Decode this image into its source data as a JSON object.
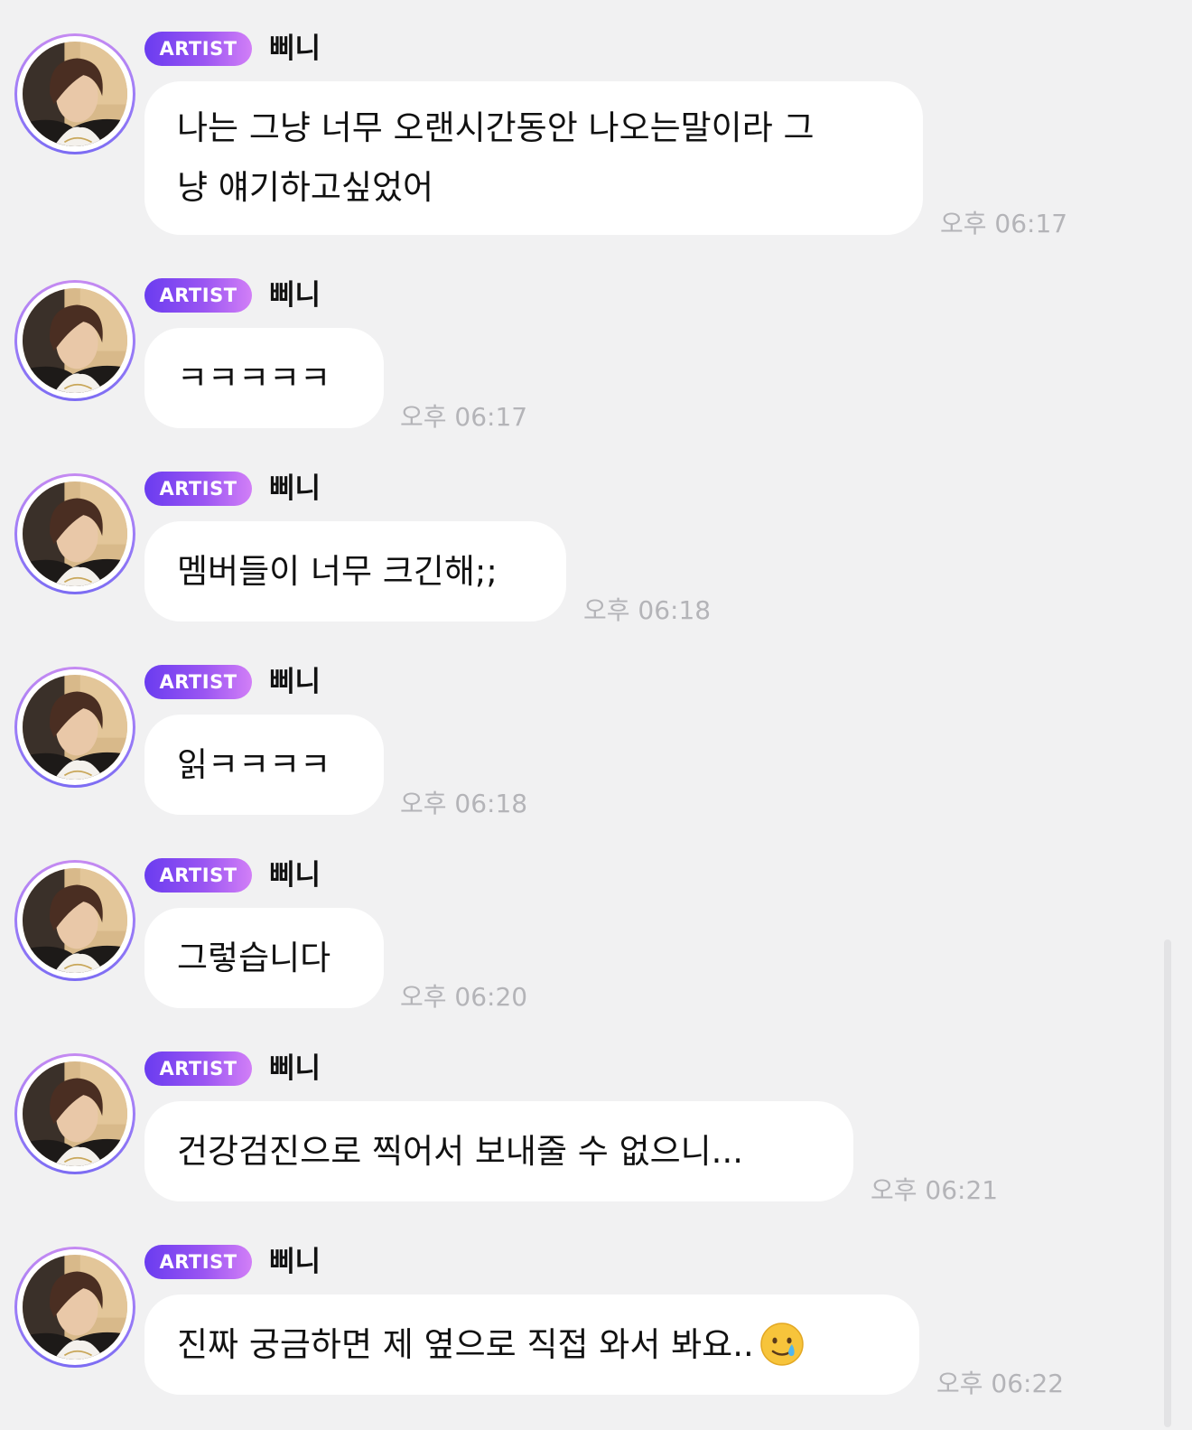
{
  "colors": {
    "background": "#f1f1f2",
    "bubble": "#ffffff",
    "badge_gradient_start": "#6a3cf0",
    "badge_gradient_end": "#d27ff7",
    "timestamp": "#b4b4b8"
  },
  "messages": [
    {
      "badge": "ARTIST",
      "sender": "삐니",
      "text": "나는 그냥 너무 오랜시간동안 나오는말이라 그\n냥 얘기하고싶었어",
      "time": "오후 06:17"
    },
    {
      "badge": "ARTIST",
      "sender": "삐니",
      "text": "ㅋㅋㅋㅋㅋ",
      "time": "오후 06:17"
    },
    {
      "badge": "ARTIST",
      "sender": "삐니",
      "text": "멤버들이 너무 크긴해;;",
      "time": "오후 06:18"
    },
    {
      "badge": "ARTIST",
      "sender": "삐니",
      "text": "읽ㅋㅋㅋㅋ",
      "time": "오후 06:18"
    },
    {
      "badge": "ARTIST",
      "sender": "삐니",
      "text": "그렇습니다",
      "time": "오후 06:20"
    },
    {
      "badge": "ARTIST",
      "sender": "삐니",
      "text": "건강검진으로 찍어서 보내줄 수 없으니...",
      "time": "오후 06:21"
    },
    {
      "badge": "ARTIST",
      "sender": "삐니",
      "text": "진짜 궁금하면 제 옆으로 직접 와서 봐요..",
      "emoji": "smiling-face-with-tear",
      "time": "오후 06:22"
    }
  ]
}
